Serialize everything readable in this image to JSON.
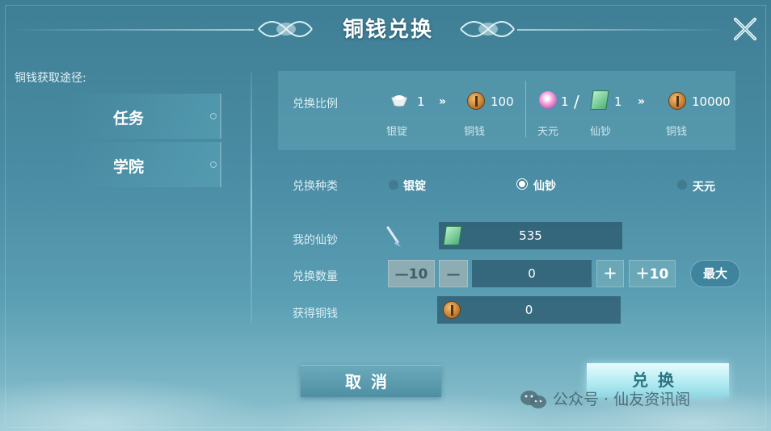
{
  "header": {
    "title": "铜钱兑换"
  },
  "sidebar": {
    "source_label": "铜钱获取途径:",
    "items": [
      {
        "label": "任务"
      },
      {
        "label": "学院"
      }
    ]
  },
  "ratio": {
    "label": "兑换比例",
    "group1": {
      "from_amount": "1",
      "from_name": "银锭",
      "arrow": "»",
      "to_amount": "100",
      "to_name": "铜钱"
    },
    "group2": {
      "a_amount": "1",
      "a_name": "天元",
      "slash": "/",
      "b_amount": "1",
      "b_name": "仙钞",
      "arrow": "»",
      "to_amount": "10000",
      "to_name": "铜钱"
    }
  },
  "type_select": {
    "label": "兑换种类",
    "options": [
      {
        "label": "银锭",
        "selected": false
      },
      {
        "label": "仙钞",
        "selected": true
      },
      {
        "label": "天元",
        "selected": false
      }
    ]
  },
  "my_balance": {
    "label": "我的仙钞",
    "value": "535"
  },
  "quantity": {
    "label": "兑换数量",
    "minus10": "—10",
    "minus": "—",
    "value": "0",
    "plus": "＋",
    "plus10": "＋10",
    "max": "最大"
  },
  "gain": {
    "label": "获得铜钱",
    "value": "0"
  },
  "actions": {
    "cancel": "取消",
    "confirm": "兑换"
  },
  "watermark": {
    "text": "公众号 · 仙友资讯阁"
  },
  "colors": {
    "panel": "#4a8ca3",
    "field": "#2f6478",
    "confirm": "#b4ecf2",
    "cancel": "#5f9fb2"
  },
  "icons": [
    "close-icon",
    "silver-ingot-icon",
    "copper-coin-icon",
    "pearl-icon",
    "note-icon",
    "brush-icon",
    "wechat-icon"
  ]
}
